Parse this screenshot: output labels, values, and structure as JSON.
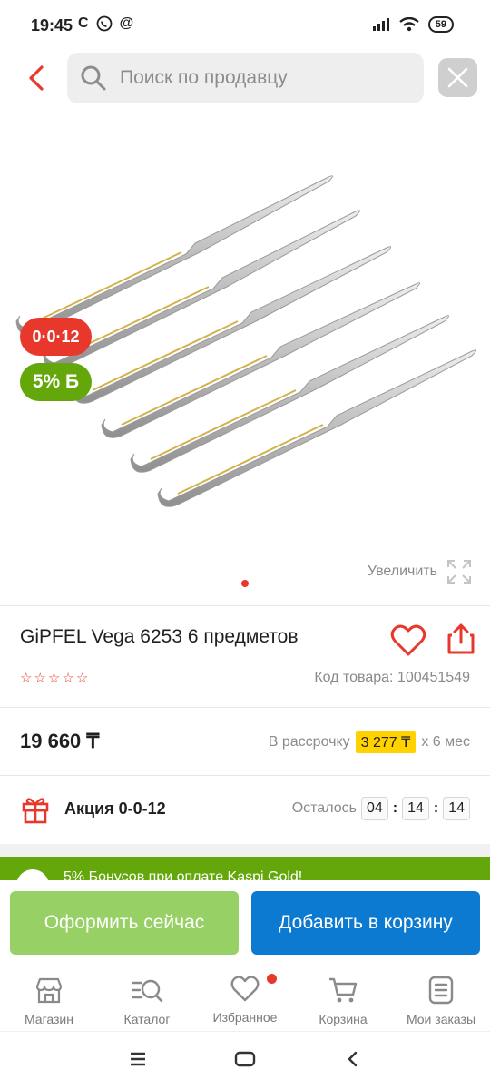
{
  "status_bar": {
    "time": "19:45",
    "left_icons": [
      "C",
      "whatsapp-icon",
      "@"
    ],
    "battery": "59"
  },
  "search": {
    "placeholder": "Поиск по продавцу"
  },
  "product": {
    "badges": {
      "promo": "0·0·12",
      "bonus": "5% Б"
    },
    "zoom_label": "Увеличить",
    "title": "GiPFEL Vega 6253 6 предметов",
    "rating_stars": 0,
    "sku_label": "Код товара: 100451549",
    "price": "19 660 ₸",
    "installment": {
      "prefix": "В рассрочку",
      "monthly": "3 277 ₸",
      "suffix": "х 6 мес"
    },
    "promo": {
      "name": "Акция 0-0-12",
      "remaining_label": "Осталось",
      "hours": "04",
      "minutes": "14",
      "seconds": "14"
    }
  },
  "gold_banner": {
    "text": "5% Бонусов при оплате Kaspi Gold!"
  },
  "actions": {
    "checkout": "Оформить сейчас",
    "add_to_cart": "Добавить в корзину"
  },
  "bottom_nav": [
    {
      "label": "Магазин",
      "icon": "store-icon"
    },
    {
      "label": "Каталог",
      "icon": "catalog-search-icon"
    },
    {
      "label": "Избранное",
      "icon": "heart-icon"
    },
    {
      "label": "Корзина",
      "icon": "cart-icon"
    },
    {
      "label": "Мои заказы",
      "icon": "orders-icon"
    }
  ],
  "colors": {
    "accent_red": "#e8382c",
    "kaspi_green": "#64a70b",
    "checkout_green": "#97d064",
    "cart_blue": "#0d7ad1",
    "installment_yellow": "#ffd200"
  }
}
